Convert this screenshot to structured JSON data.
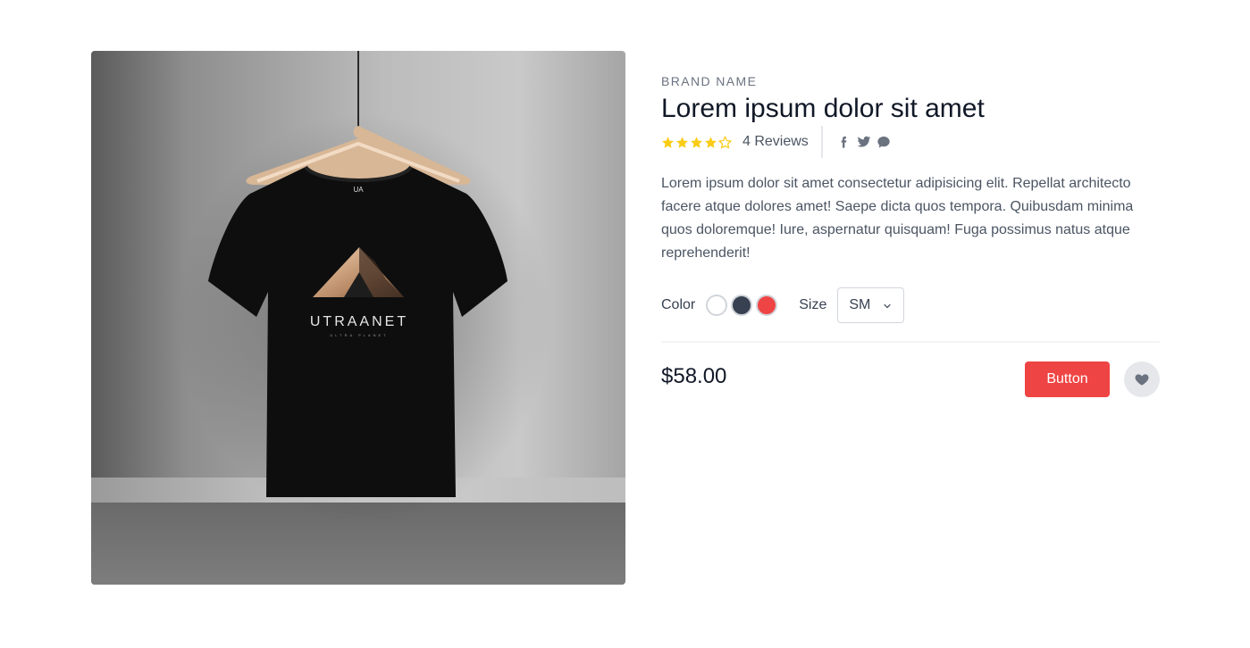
{
  "product": {
    "brand": "BRAND NAME",
    "title": "Lorem ipsum dolor sit amet",
    "rating": 4,
    "rating_max": 5,
    "reviews_label": "4 Reviews",
    "social_icons": [
      "facebook-icon",
      "twitter-icon",
      "chat-icon"
    ],
    "description": "Lorem ipsum dolor sit amet consectetur adipisicing elit. Repellat architecto facere atque dolores amet! Saepe dicta quos tempora. Quibusdam minima quos doloremque! Iure, aspernatur quisquam! Fuga possimus natus atque reprehenderit!",
    "color_label": "Color",
    "colors": [
      "#ffffff",
      "#374151",
      "#ef4444"
    ],
    "size_label": "Size",
    "size_selected": "SM",
    "price": "$58.00",
    "button_label": "Button"
  },
  "image": {
    "shirt_print_text": "UTRAANET",
    "shirt_print_subtext": "ULTRA PLANET",
    "shirt_tag_text": "UA"
  },
  "colors": {
    "accent": "#ef4444",
    "star": "#facc15",
    "text_muted": "#6b7280"
  }
}
